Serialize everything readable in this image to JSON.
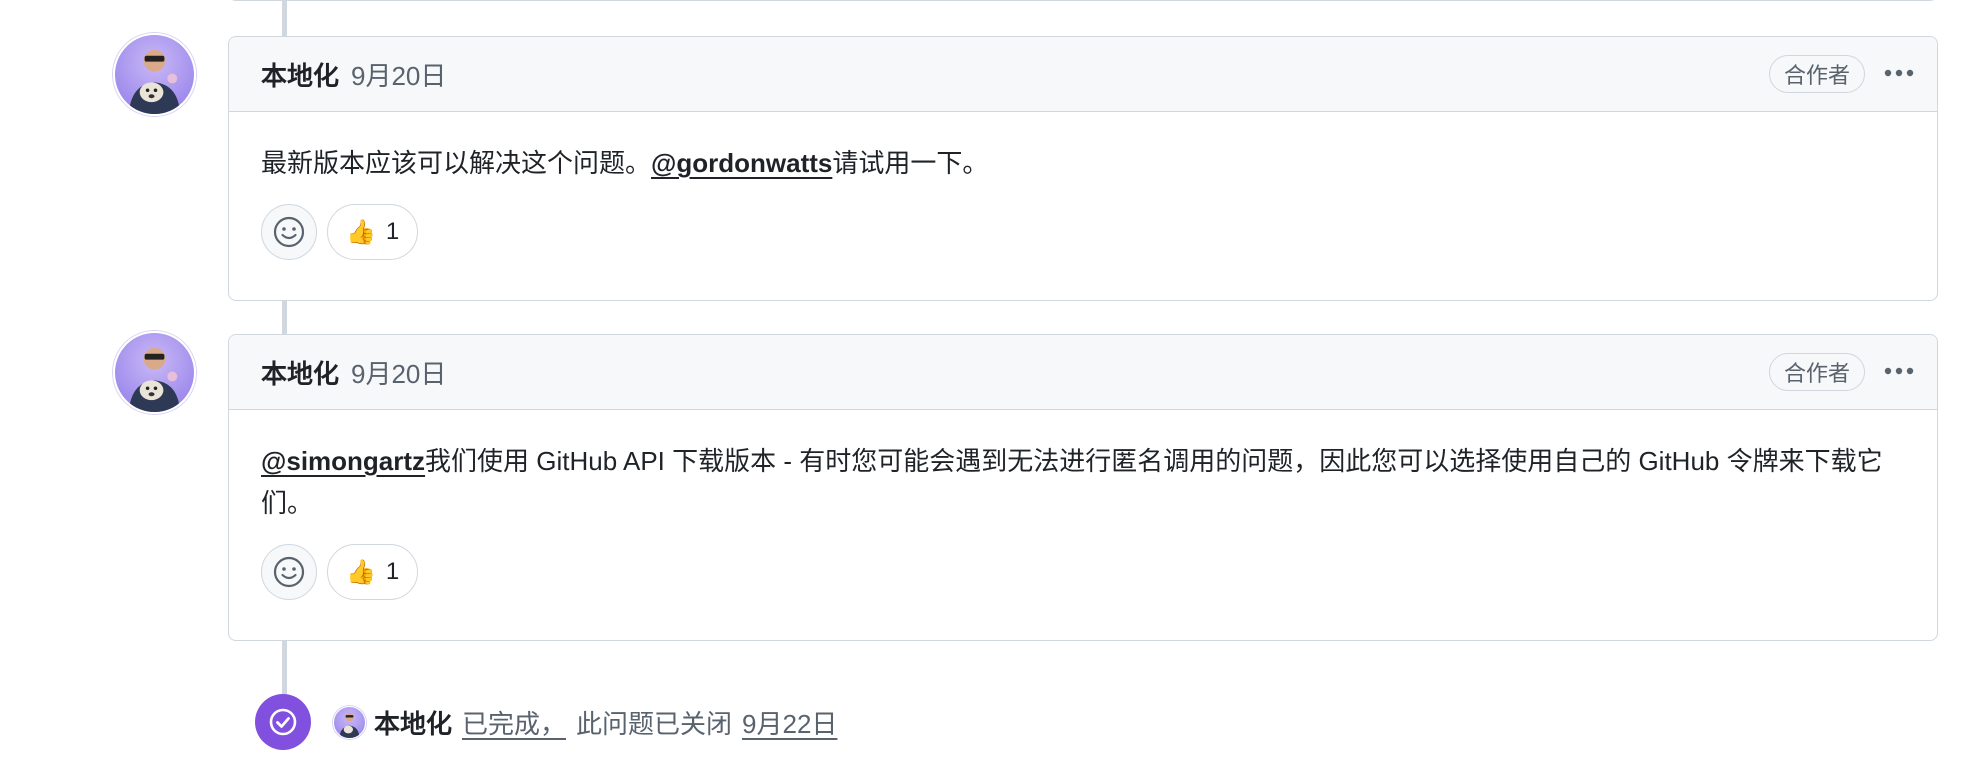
{
  "comments": [
    {
      "author": "本地化",
      "date": "9月20日",
      "role": "合作者",
      "body_prefix": "最新版本应该可以解决这个问题。",
      "mention": "@gordonwatts",
      "body_suffix": "请试用一下。",
      "reaction_count": "1"
    },
    {
      "author": "本地化",
      "date": "9月20日",
      "role": "合作者",
      "mention": "@simongartz",
      "body_suffix": "我们使用 GitHub API 下载版本 - 有时您可能会遇到无法进行匿名调用的问题，因此您可以选择使用自己的 GitHub 令牌来下载它们。",
      "reaction_count": "1"
    }
  ],
  "event": {
    "author": "本地化",
    "action": "已完成，",
    "text": "此问题已关闭",
    "date": "9月22日"
  },
  "icons": {
    "reaction_emoji": "👍",
    "add_reaction": "smiley-icon",
    "more": "kebab-horizontal-icon",
    "closed": "check-circle-icon"
  },
  "colors": {
    "closed_badge": "#8250df",
    "border": "#d0d7de",
    "header_bg": "#f6f8fa",
    "muted_text": "#59636e"
  }
}
